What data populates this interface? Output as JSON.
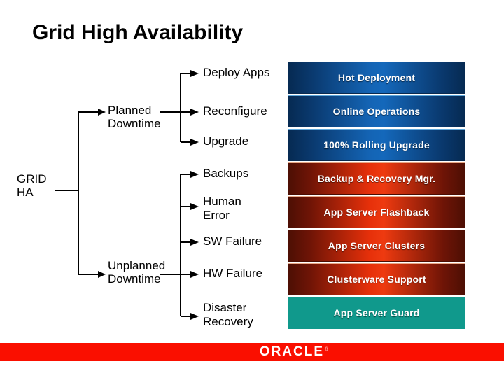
{
  "slide": {
    "title": "Grid High Availability",
    "background_color": "#ffffff"
  },
  "diagram": {
    "type": "tree",
    "root": {
      "label": "GRID\nHA"
    },
    "branches": [
      {
        "id": "planned",
        "label": "Planned\nDowntime"
      },
      {
        "id": "unplanned",
        "label": "Unplanned\nDowntime"
      }
    ],
    "rows": [
      {
        "cause": "Deploy Apps",
        "solution": "Hot Deployment",
        "branch": "planned",
        "color": "#1464b4",
        "style": "blue"
      },
      {
        "cause": "Reconfigure",
        "solution": "Online Operations",
        "branch": "planned",
        "color": "#1464b4",
        "style": "blue"
      },
      {
        "cause": "Upgrade",
        "solution": "100% Rolling Upgrade",
        "branch": "planned",
        "color": "#1464b4",
        "style": "blue"
      },
      {
        "cause": "Backups",
        "solution": "Backup & Recovery Mgr.",
        "branch": "unplanned",
        "color": "#e6300a",
        "style": "red"
      },
      {
        "cause": "Human\nError",
        "solution": "App Server Flashback",
        "branch": "unplanned",
        "color": "#e6300a",
        "style": "red"
      },
      {
        "cause": "SW Failure",
        "solution": "App Server Clusters",
        "branch": "unplanned",
        "color": "#e6300a",
        "style": "red"
      },
      {
        "cause": "HW Failure",
        "solution": "Clusterware Support",
        "branch": "unplanned",
        "color": "#e6300a",
        "style": "red"
      },
      {
        "cause": "Disaster\nRecovery",
        "solution": "App Server Guard",
        "branch": "unplanned",
        "color": "#10998c",
        "style": "teal"
      }
    ]
  },
  "footer": {
    "logo_text": "ORACLE",
    "trademark": "®",
    "bar_color": "#fa0f00",
    "logo_color": "#ffffff"
  }
}
